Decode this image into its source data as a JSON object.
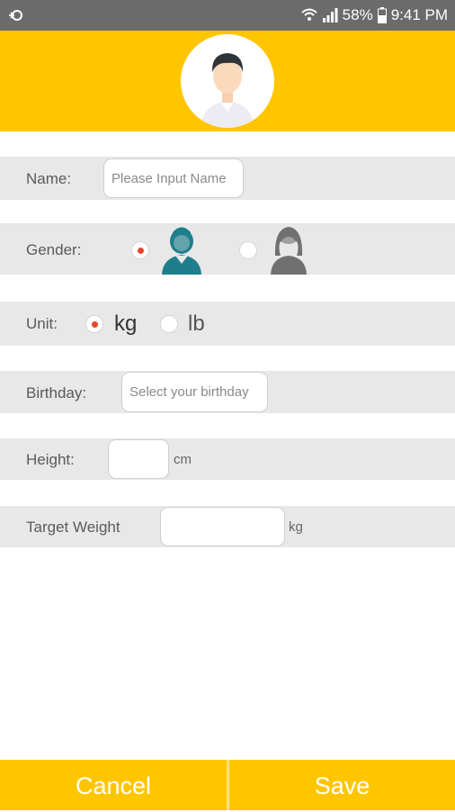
{
  "status_bar": {
    "battery": "58%",
    "time": "9:41 PM",
    "icons": [
      "sync-icon",
      "wifi-icon",
      "signal-icon",
      "battery-icon"
    ]
  },
  "avatar": {
    "icon": "male-avatar-icon"
  },
  "form": {
    "name": {
      "label": "Name:",
      "placeholder": "Please Input Name",
      "value": ""
    },
    "gender": {
      "label": "Gender:",
      "selected": "male",
      "options": [
        "male-icon",
        "female-icon"
      ]
    },
    "unit": {
      "label": "Unit:",
      "options": [
        "kg",
        "lb"
      ],
      "selected": "kg"
    },
    "birthday": {
      "label": "Birthday:",
      "placeholder": "Select your birthday",
      "value": ""
    },
    "height": {
      "label": "Height:",
      "value": "",
      "unit": "cm"
    },
    "target_weight": {
      "label": "Target Weight",
      "value": "",
      "unit": "kg"
    }
  },
  "buttons": {
    "cancel": "Cancel",
    "save": "Save"
  },
  "colors": {
    "accent": "#ffc600",
    "row_bg": "#e8e8e8",
    "radio_dot": "#e8462b",
    "male_icon": "#1e7e8c",
    "female_icon": "#707070"
  }
}
